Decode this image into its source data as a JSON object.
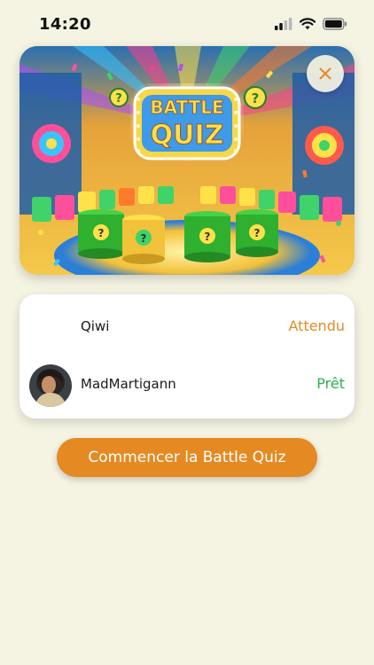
{
  "status_bar": {
    "time": "14:20",
    "icons": [
      "cellular-signal-icon",
      "wifi-icon",
      "battery-icon"
    ]
  },
  "hero": {
    "image": "battle-quiz-game-show-illustration",
    "sign_line1": "BATTLE",
    "sign_line2": "QUIZ",
    "close_icon": "close-icon"
  },
  "players": [
    {
      "name": "Qiwi",
      "status": "Attendu",
      "status_color": "#e58a22",
      "has_avatar": false
    },
    {
      "name": "MadMartigann",
      "status": "Prêt",
      "status_color": "#2bb24c",
      "has_avatar": true
    }
  ],
  "start_button": {
    "label": "Commencer la Battle Quiz",
    "color": "#e58a22"
  },
  "colors": {
    "background": "#f5f3e2",
    "accent": "#e58a22",
    "ready": "#2bb24c"
  }
}
